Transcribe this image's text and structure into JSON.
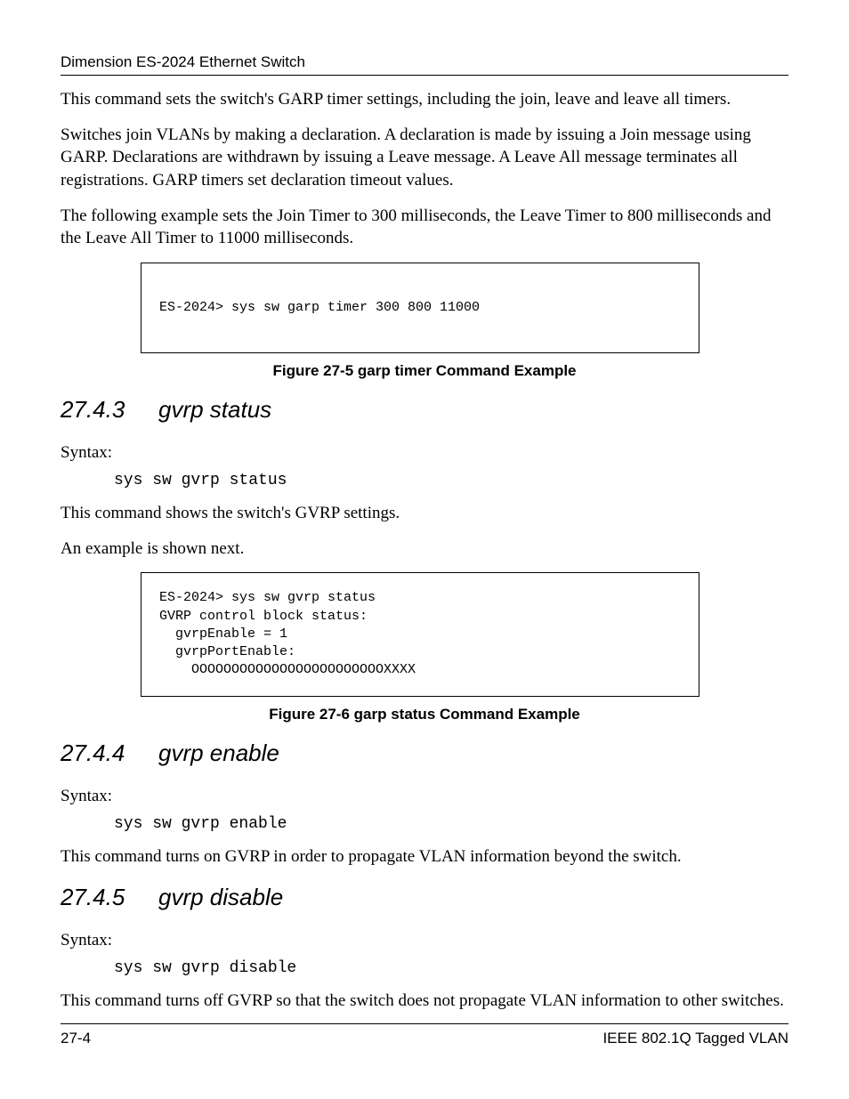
{
  "header": {
    "title": "Dimension ES-2024 Ethernet Switch"
  },
  "intro": {
    "p1": "This command sets the switch's GARP timer settings, including the join, leave and leave all timers.",
    "p2": "Switches join VLANs by making a declaration. A declaration is made by issuing a Join message using GARP. Declarations are withdrawn by issuing a Leave message. A Leave All message terminates all registrations. GARP timers set declaration timeout values.",
    "p3": "The following example sets the Join Timer to 300 milliseconds, the Leave Timer to 800 milliseconds and the Leave All Timer to 11000 milliseconds."
  },
  "example1": {
    "code": "ES-2024> sys sw garp timer 300 800 11000",
    "caption": "Figure 27-5 garp timer Command Example"
  },
  "sec_2743": {
    "num": "27.4.3",
    "title": "gvrp status",
    "syntax_label": "Syntax:",
    "syntax_cmd": "sys sw gvrp status",
    "desc": "This command shows the switch's GVRP settings.",
    "example_intro": "An example is shown next."
  },
  "example2": {
    "code": "ES-2024> sys sw gvrp status\nGVRP control block status:\n  gvrpEnable = 1\n  gvrpPortEnable:\n    OOOOOOOOOOOOOOOOOOOOOOOOXXXX",
    "caption": "Figure 27-6 garp status Command Example"
  },
  "sec_2744": {
    "num": "27.4.4",
    "title": "gvrp enable",
    "syntax_label": "Syntax:",
    "syntax_cmd": "sys sw gvrp enable",
    "desc": "This command turns on GVRP in order to propagate VLAN information beyond the switch."
  },
  "sec_2745": {
    "num": "27.4.5",
    "title": "gvrp disable",
    "syntax_label": "Syntax:",
    "syntax_cmd": "sys sw gvrp disable",
    "desc": "This command turns off GVRP so that the switch does not propagate VLAN information to other switches."
  },
  "footer": {
    "page": "27-4",
    "right": "IEEE 802.1Q Tagged VLAN"
  }
}
